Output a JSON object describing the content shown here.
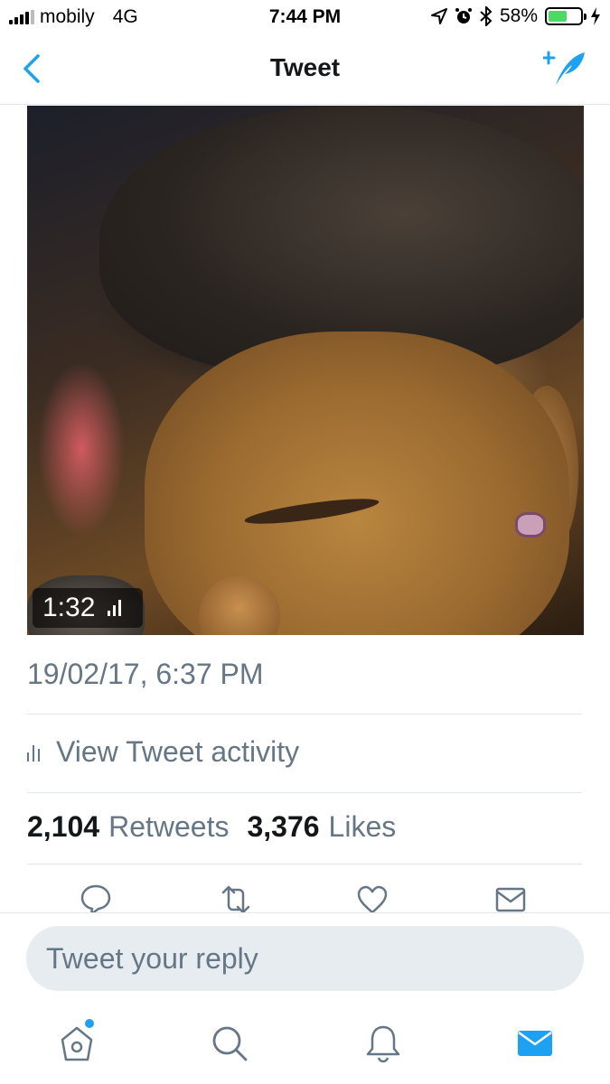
{
  "status_bar": {
    "carrier": "mobily",
    "network": "4G",
    "time": "7:44 PM",
    "battery_percent": "58%",
    "battery_level": 0.58
  },
  "nav": {
    "title": "Tweet",
    "back_icon": "chevron-left-icon",
    "compose_icon": "compose-tweet-icon"
  },
  "media": {
    "type": "video",
    "duration": "1:32"
  },
  "tweet": {
    "timestamp": "19/02/17, 6:37 PM",
    "activity_label": "View Tweet activity",
    "retweets_count": "2,104",
    "retweets_label": "Retweets",
    "likes_count": "3,376",
    "likes_label": "Likes"
  },
  "actions": [
    {
      "name": "reply",
      "icon": "reply-icon"
    },
    {
      "name": "retweet",
      "icon": "retweet-icon"
    },
    {
      "name": "like",
      "icon": "heart-icon"
    },
    {
      "name": "share",
      "icon": "mail-icon"
    }
  ],
  "reply": {
    "placeholder": "Tweet your reply"
  },
  "tabs": [
    {
      "name": "home",
      "icon": "home-icon",
      "has_badge": true
    },
    {
      "name": "search",
      "icon": "search-icon"
    },
    {
      "name": "notifications",
      "icon": "bell-icon"
    },
    {
      "name": "messages",
      "icon": "mail-icon",
      "active": true
    }
  ],
  "colors": {
    "accent": "#1da1f2",
    "secondary_text": "#657786",
    "divider": "#e1e8ed",
    "reply_bg": "#e6ecf0",
    "battery": "#4cd964"
  }
}
